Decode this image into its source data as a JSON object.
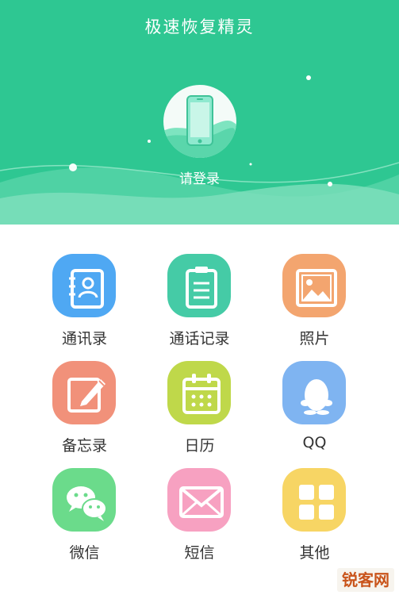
{
  "app": {
    "title": "极速恢复精灵",
    "login_label": "请登录"
  },
  "colors": {
    "header_bg": "#2ec792",
    "label_text": "#333333"
  },
  "tiles": [
    {
      "label": "通讯录",
      "icon": "contacts-icon",
      "color": "#4fa8f3"
    },
    {
      "label": "通话记录",
      "icon": "call-log-icon",
      "color": "#45cba6"
    },
    {
      "label": "照片",
      "icon": "photo-icon",
      "color": "#f3a56f"
    },
    {
      "label": "备忘录",
      "icon": "memo-icon",
      "color": "#f1917a"
    },
    {
      "label": "日历",
      "icon": "calendar-icon",
      "color": "#bfd84a"
    },
    {
      "label": "QQ",
      "icon": "qq-icon",
      "color": "#7fb4f1"
    },
    {
      "label": "微信",
      "icon": "wechat-icon",
      "color": "#6bdb8b"
    },
    {
      "label": "短信",
      "icon": "sms-icon",
      "color": "#f7a1c1"
    },
    {
      "label": "其他",
      "icon": "other-icon",
      "color": "#f7d564"
    }
  ],
  "watermark": {
    "text": "锐客网"
  }
}
